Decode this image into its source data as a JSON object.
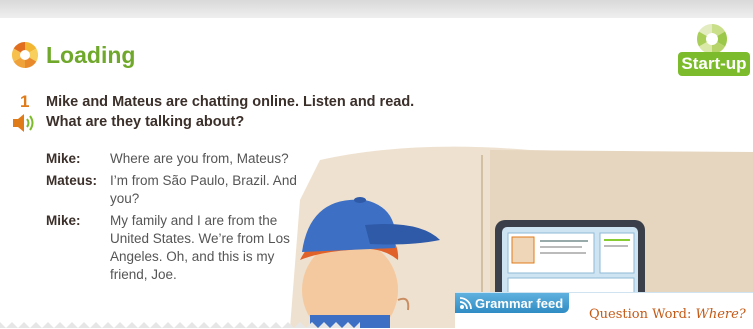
{
  "header": {
    "title": "Loading",
    "badge": "Start-up"
  },
  "exercise": {
    "number": "1",
    "instruction_line1": "Mike and Mateus are chatting online. Listen and read.",
    "instruction_line2": "What are they talking about?"
  },
  "dialog": [
    {
      "speaker": "Mike:",
      "text": "Where are you from, Mateus?"
    },
    {
      "speaker": "Mateus:",
      "text": "I’m from São Paulo, Brazil. And you?"
    },
    {
      "speaker": "Mike:",
      "text": "My family and I are from the United States. We’re from Los Angeles. Oh, and this is my friend, Joe."
    }
  ],
  "grammar_feed": {
    "label": "Grammar feed",
    "subtitle_prefix": "Question Word: ",
    "subtitle_word": "Where?"
  },
  "colors": {
    "green": "#6fa82a",
    "orange": "#e07b1a",
    "blue": "#2f8cc4"
  }
}
